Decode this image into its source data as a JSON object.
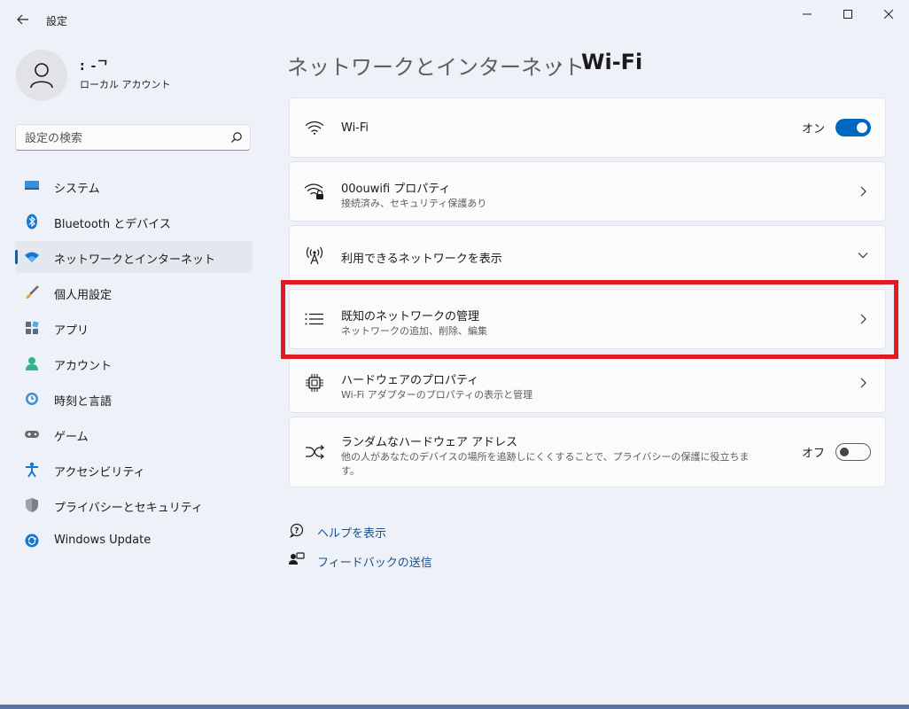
{
  "window": {
    "title": "設定",
    "controls": [
      "minimize",
      "maximize",
      "close"
    ]
  },
  "user": {
    "name": ": -ᄀ",
    "account_type": "ローカル アカウント"
  },
  "search": {
    "placeholder": "設定の検索"
  },
  "sidebar": {
    "items": [
      {
        "label": "システム",
        "icon": "system-icon"
      },
      {
        "label": "Bluetooth とデバイス",
        "icon": "bluetooth-icon"
      },
      {
        "label": "ネットワークとインターネット",
        "icon": "wifi-network-icon",
        "active": true
      },
      {
        "label": "個人用設定",
        "icon": "brush-icon"
      },
      {
        "label": "アプリ",
        "icon": "apps-icon"
      },
      {
        "label": "アカウント",
        "icon": "account-icon"
      },
      {
        "label": "時刻と言語",
        "icon": "time-language-icon"
      },
      {
        "label": "ゲーム",
        "icon": "gaming-icon"
      },
      {
        "label": "アクセシビリティ",
        "icon": "accessibility-icon"
      },
      {
        "label": "プライバシーとセキュリティ",
        "icon": "shield-icon"
      },
      {
        "label": "Windows Update",
        "icon": "update-icon"
      }
    ]
  },
  "breadcrumb": {
    "parent": "ネットワークとインターネット",
    "separator": "›",
    "current": "Wi-Fi"
  },
  "settings": {
    "wifi": {
      "title": "Wi-Fi",
      "toggle_label": "オン",
      "toggle_on": true
    },
    "properties": {
      "title": "00ouwifi プロパティ",
      "subtitle": "接続済み、セキュリティ保護あり"
    },
    "available": {
      "title": "利用できるネットワークを表示"
    },
    "known": {
      "title": "既知のネットワークの管理",
      "subtitle": "ネットワークの追加、削除、編集"
    },
    "hardware": {
      "title": "ハードウェアのプロパティ",
      "subtitle": "Wi-Fi アダプターのプロパティの表示と管理"
    },
    "random": {
      "title": "ランダムなハードウェア アドレス",
      "subtitle_line1": "他の人があなたのデバイスの場所を追跡しにくくすることで、プライバシーの保護に役立ちま",
      "subtitle_line2": "す。",
      "toggle_label": "オフ",
      "toggle_on": false
    }
  },
  "links": {
    "help": "ヘルプを表示",
    "feedback": "フィードバックの送信"
  },
  "colors": {
    "accent": "#0067c0",
    "highlight": "#e01b24",
    "background": "#eef2f8"
  }
}
